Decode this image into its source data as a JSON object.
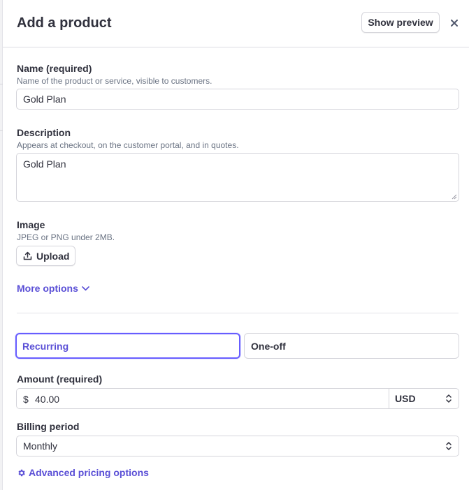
{
  "header": {
    "title": "Add a product",
    "preview_label": "Show preview"
  },
  "name_field": {
    "label": "Name (required)",
    "hint": "Name of the product or service, visible to customers.",
    "value": "Gold Plan"
  },
  "description_field": {
    "label": "Description",
    "hint": "Appears at checkout, on the customer portal, and in quotes.",
    "value": "Gold Plan"
  },
  "image_field": {
    "label": "Image",
    "hint": "JPEG or PNG under 2MB.",
    "upload_label": "Upload"
  },
  "more_options_label": "More options",
  "pricing_type": {
    "options": [
      "Recurring",
      "One-off"
    ],
    "selected": "Recurring"
  },
  "amount_field": {
    "label": "Amount (required)",
    "currency_symbol": "$",
    "value": "40.00",
    "currency": "USD"
  },
  "billing_field": {
    "label": "Billing period",
    "value": "Monthly"
  },
  "advanced_label": "Advanced pricing options",
  "colors": {
    "accent": "#5a4fd6",
    "border": "#d5d5db",
    "text": "#30313d",
    "hint": "#6a7383"
  },
  "icons": [
    "close-icon",
    "upload-icon",
    "chevron-down-icon",
    "select-arrows-icon",
    "gear-icon"
  ]
}
